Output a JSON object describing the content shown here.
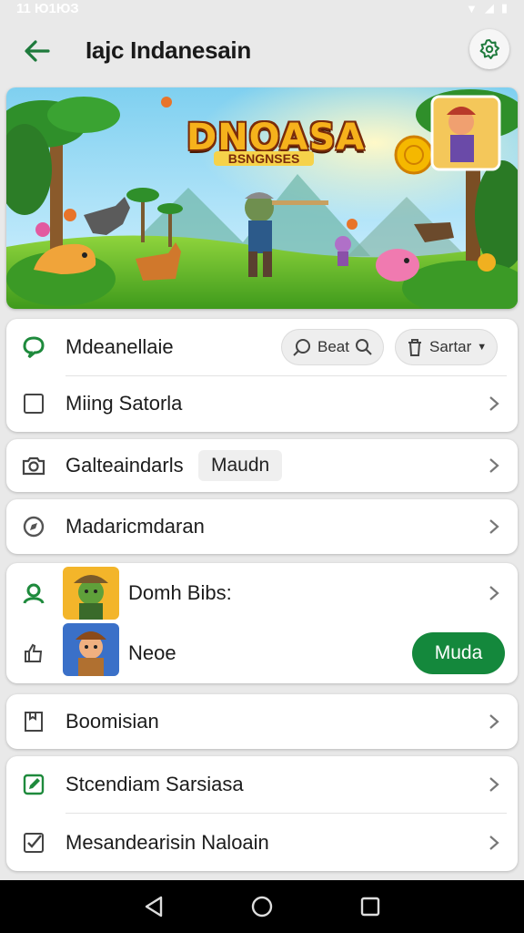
{
  "status_bar": {
    "time": "11 Ю1ЮЗ"
  },
  "app_bar": {
    "title": "Iajc Indanesain"
  },
  "banner": {
    "logo_title": "DNOASA",
    "logo_subtitle": "BSNGNSES"
  },
  "card1": {
    "row1": {
      "label": "Mdeanellaie",
      "search_pill": "Beat",
      "sort_pill": "Sartar"
    },
    "row2": {
      "label": "Miing Satorla"
    }
  },
  "card2": {
    "label": "Galteaindarls",
    "tag": "Maudn"
  },
  "card3": {
    "label": "Madaricmdaran"
  },
  "card4": {
    "row1": {
      "label": "Domh Bibs:"
    },
    "row2": {
      "label": "Neoe",
      "button": "Muda"
    }
  },
  "card5": {
    "label": "Boomisian"
  },
  "card6": {
    "row1": {
      "label": "Stcendiam Sarsiasa"
    },
    "row2": {
      "label": "Mesandearisin Naloain"
    }
  },
  "colors": {
    "accent_green": "#14883c",
    "nav_bg": "#000000"
  }
}
